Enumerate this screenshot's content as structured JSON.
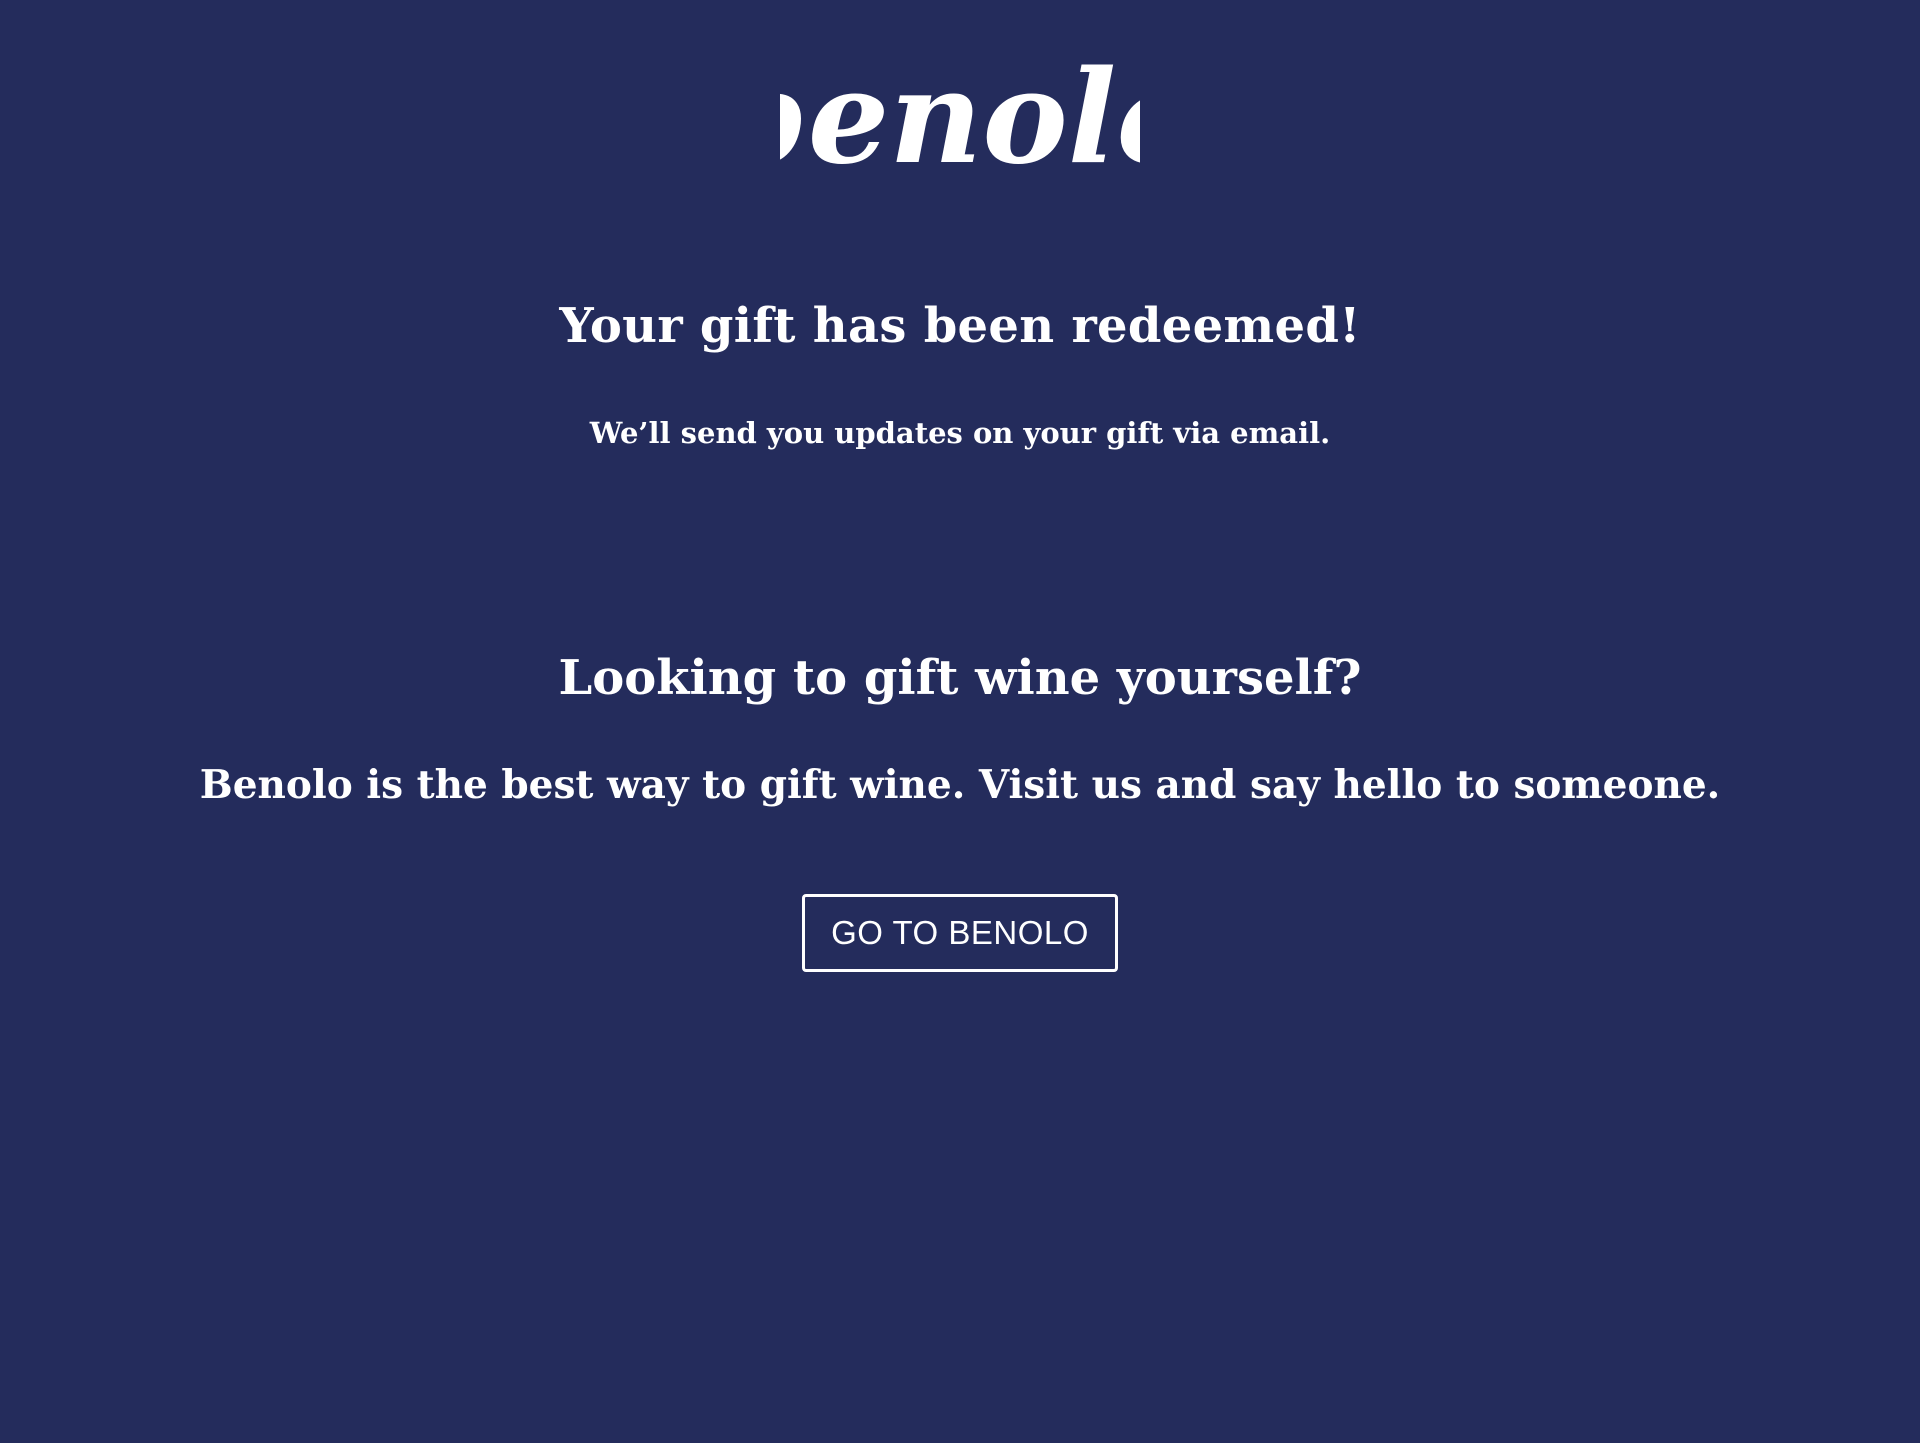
{
  "header": {
    "logo_text": "benolo"
  },
  "confirmation": {
    "title": "Your gift has been redeemed!",
    "subtitle": "We’ll send you updates on your gift via email."
  },
  "promo": {
    "heading": "Looking to gift wine yourself?",
    "body": "Benolo is the best way to gift wine. Visit us and say hello to someone.",
    "button_label": "GO TO BENOLO"
  },
  "colors": {
    "background": "#242c5c",
    "text": "#ffffff",
    "button_border": "#ffffff"
  }
}
